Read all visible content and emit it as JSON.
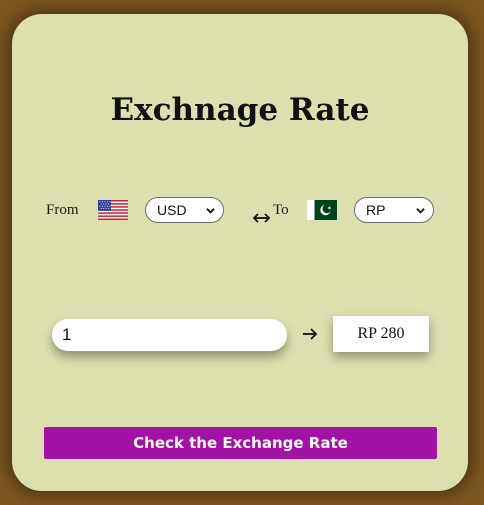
{
  "title": "Exchnage Rate",
  "from_label": "From",
  "to_label": "To",
  "from_currency": {
    "selected": "USD",
    "flag": "us-flag-icon"
  },
  "to_currency": {
    "selected": "RP",
    "flag": "pakistan-flag-icon"
  },
  "amount": {
    "value": "1"
  },
  "result": {
    "text": "RP 280"
  },
  "button": {
    "label": "Check the Exchange Rate"
  },
  "colors": {
    "page_background": "#7a5620",
    "card_background": "#dcdfae",
    "button": "#a312a6"
  }
}
